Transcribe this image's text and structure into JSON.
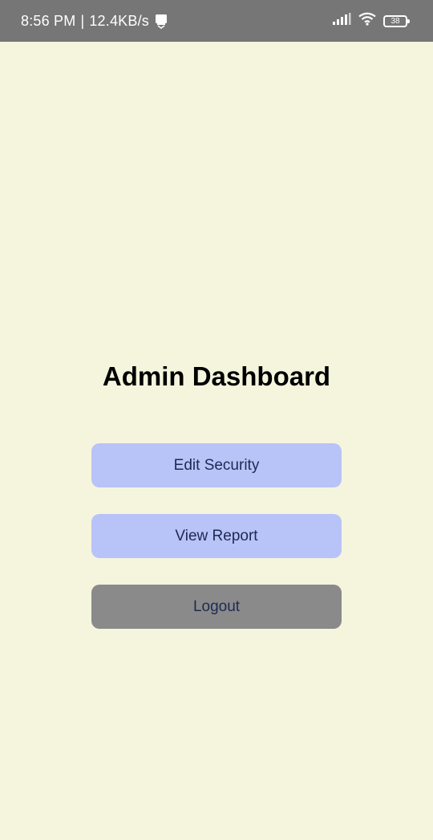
{
  "status_bar": {
    "time": "8:56 PM",
    "separator": "|",
    "network_speed": "12.4KB/s",
    "battery_level": "38",
    "icons": [
      "upload-icon",
      "signal-icon",
      "wifi-icon",
      "battery-icon"
    ]
  },
  "dashboard": {
    "title": "Admin Dashboard",
    "buttons": {
      "edit_security": "Edit Security",
      "view_report": "View Report",
      "logout": "Logout"
    }
  },
  "colors": {
    "background": "#f5f5de",
    "status_bar": "#767676",
    "primary_button": "#b8c3f8",
    "logout_button": "#8a8a8a",
    "button_text": "#1f2a52"
  }
}
